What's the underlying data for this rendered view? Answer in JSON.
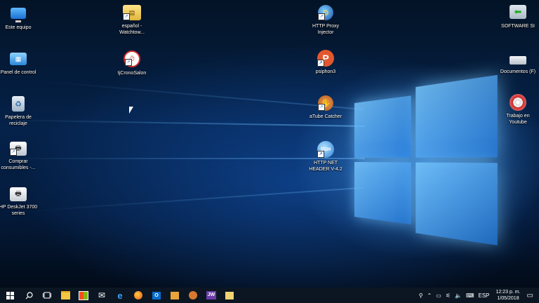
{
  "desktop": {
    "icons": [
      {
        "label": "Este equipo",
        "icon": "computer-icon"
      },
      {
        "label": "Panel de control",
        "icon": "control-panel-icon"
      },
      {
        "label": "Papelera de reciclaje",
        "icon": "recycle-bin-icon"
      },
      {
        "label": "Comprar consumibles -...",
        "icon": "printer-icon"
      },
      {
        "label": "HP DeskJet 3700 series",
        "icon": "printer-icon"
      },
      {
        "label": "español - Watchtow...",
        "icon": "folder-icon"
      },
      {
        "label": "tjCronoSalon",
        "icon": "clock-icon"
      },
      {
        "label": "HTTP Proxy Injector",
        "icon": "globe-icon"
      },
      {
        "label": "psiphon3",
        "icon": "psiphon-icon"
      },
      {
        "label": "aTube Catcher",
        "icon": "atube-icon"
      },
      {
        "label": "HTTP NET HEADER V-4.2",
        "icon": "ssh-icon"
      },
      {
        "label": "SOFTWARE SI",
        "icon": "green-arrow-icon"
      },
      {
        "label": "Documentos (F)",
        "icon": "drive-icon"
      },
      {
        "label": "Trabajo en Youtube",
        "icon": "disc-icon"
      }
    ]
  },
  "taskbar": {
    "jw_label": "JW",
    "lang": "ESP",
    "time": "12:23 p. m.",
    "date": "1/05/2018"
  }
}
